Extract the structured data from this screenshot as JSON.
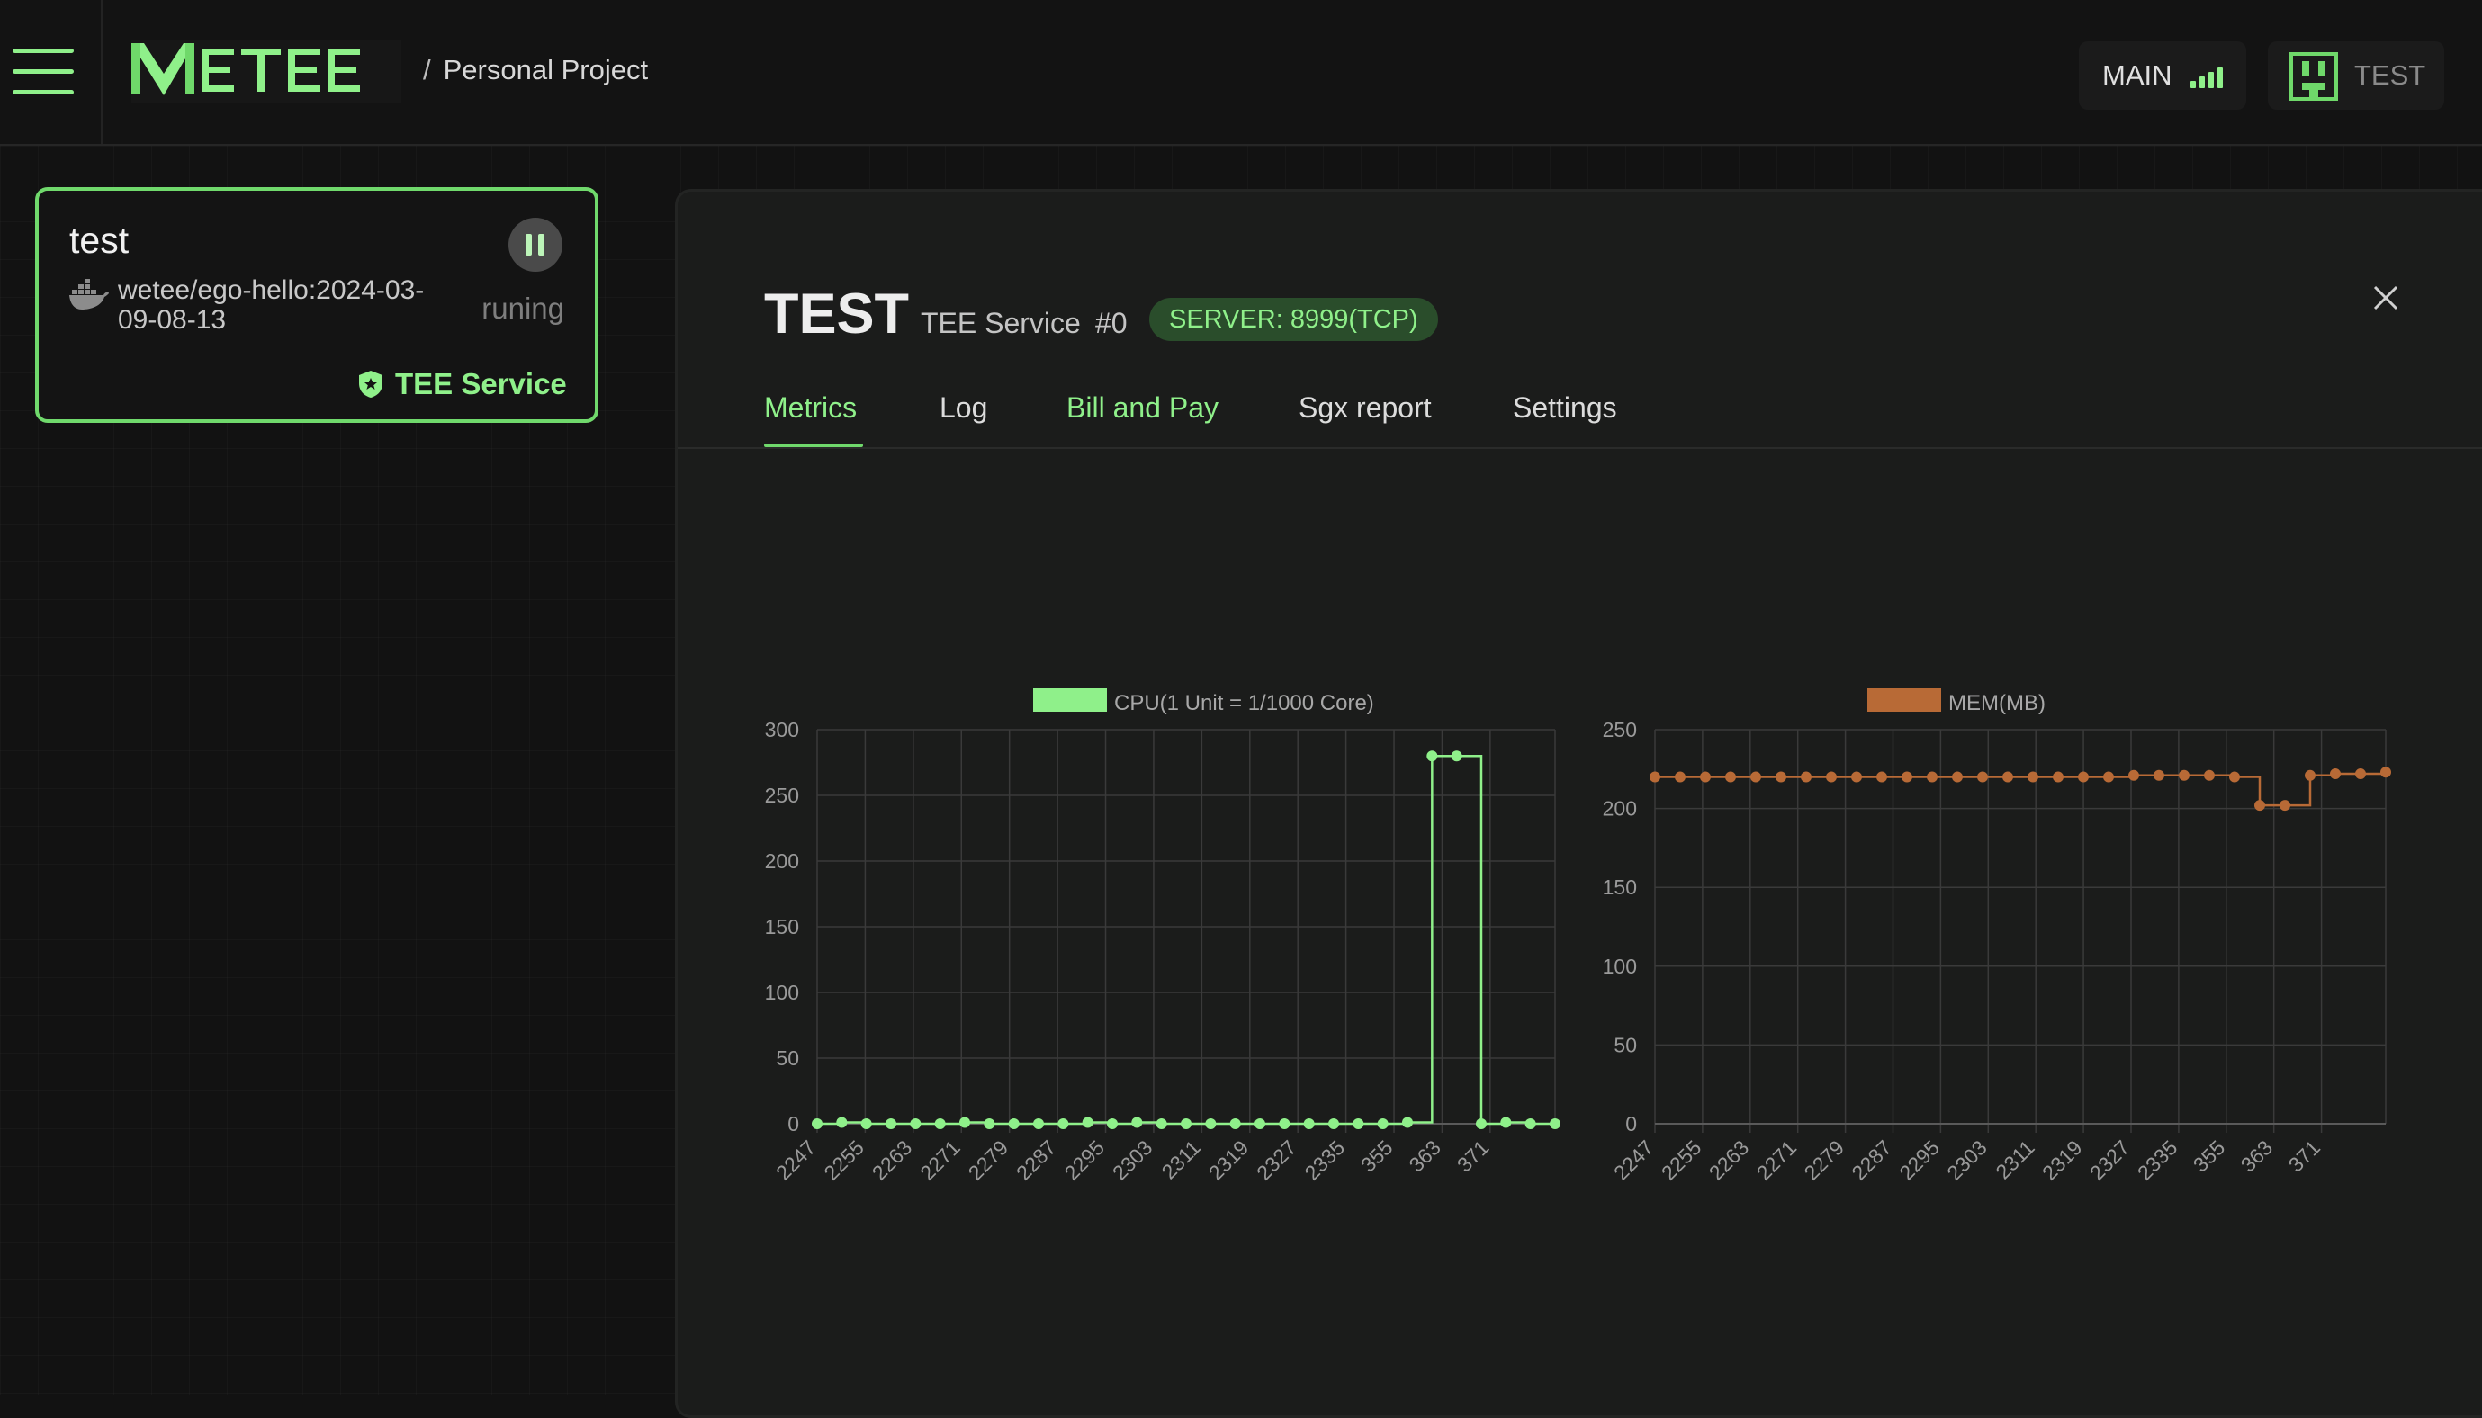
{
  "header": {
    "breadcrumb_sep": "/",
    "project_name": "Personal Project",
    "network_label": "MAIN",
    "account_label": "TEST",
    "accent": "#8ff08a"
  },
  "card": {
    "title": "test",
    "image": "wetee/ego-hello:2024-03-09-08-13",
    "status": "runing",
    "type": "TEE Service"
  },
  "panel": {
    "title": "TEST",
    "subtitle": "TEE Service",
    "index": "#0",
    "server_badge": "SERVER: 8999(TCP)",
    "tabs": [
      {
        "label": "Metrics"
      },
      {
        "label": "Log"
      },
      {
        "label": "Bill and Pay"
      },
      {
        "label": "Sgx report"
      },
      {
        "label": "Settings"
      }
    ],
    "active_tab": "Metrics"
  },
  "chart_data": [
    {
      "type": "line",
      "step": true,
      "color": "#8ff08a",
      "legend": "CPU(1 Unit = 1/1000 Core)",
      "legend_position": "top-center",
      "ylim": [
        0,
        300
      ],
      "yticks": [
        0,
        50,
        100,
        150,
        200,
        250,
        300
      ],
      "xtick_labels": [
        "2247",
        "2255",
        "2263",
        "2271",
        "2279",
        "2287",
        "2295",
        "2303",
        "2311",
        "2319",
        "2327",
        "2335",
        "355",
        "363",
        "371"
      ],
      "values": [
        0,
        1,
        0,
        0,
        0,
        0,
        1,
        0,
        0,
        0,
        0,
        1,
        0,
        1,
        0,
        0,
        0,
        0,
        0,
        0,
        0,
        0,
        0,
        0,
        1,
        280,
        280,
        0,
        1,
        0,
        0
      ],
      "grid": true
    },
    {
      "type": "line",
      "step": true,
      "color": "#b86a36",
      "legend": "MEM(MB)",
      "legend_position": "top-center",
      "ylim": [
        0,
        250
      ],
      "yticks": [
        0,
        50,
        100,
        150,
        200,
        250
      ],
      "xtick_labels": [
        "2247",
        "2255",
        "2263",
        "2271",
        "2279",
        "2287",
        "2295",
        "2303",
        "2311",
        "2319",
        "2327",
        "2335",
        "355",
        "363",
        "371"
      ],
      "values": [
        220,
        220,
        220,
        220,
        220,
        220,
        220,
        220,
        220,
        220,
        220,
        220,
        220,
        220,
        220,
        220,
        220,
        220,
        220,
        221,
        221,
        221,
        221,
        220,
        202,
        202,
        221,
        222,
        222,
        223
      ],
      "grid": true
    }
  ]
}
